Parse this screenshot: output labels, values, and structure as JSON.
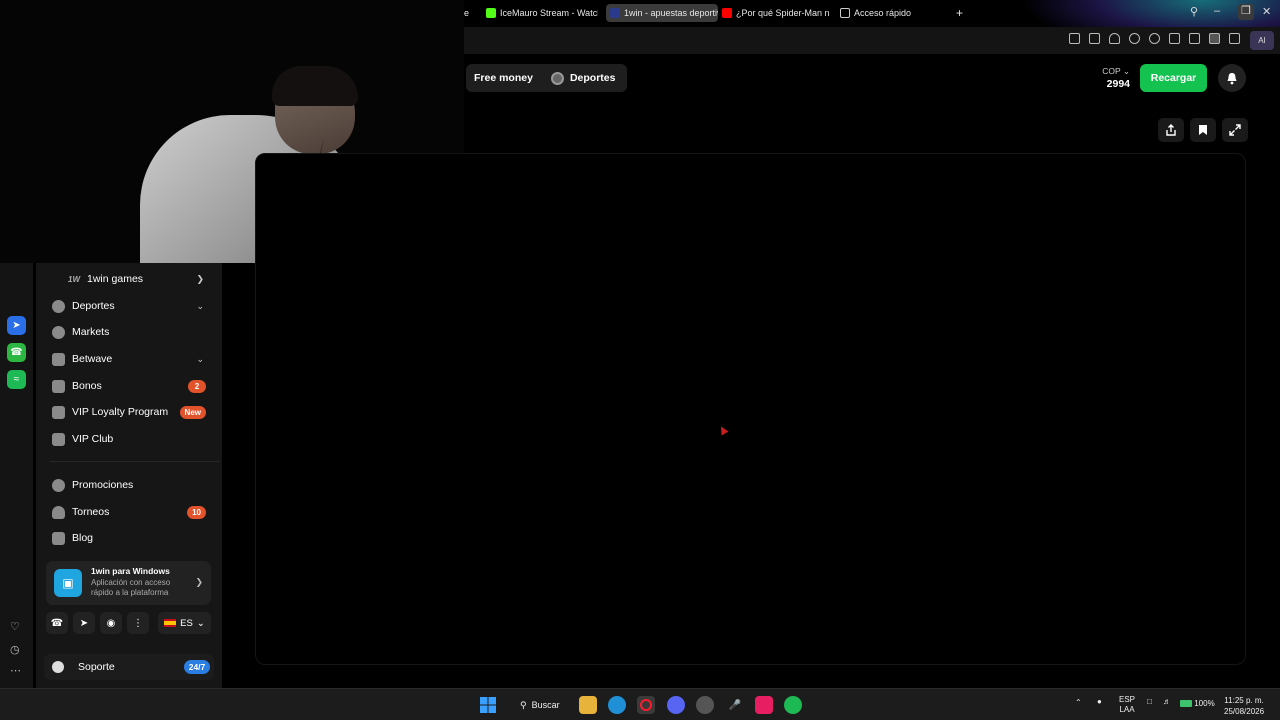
{
  "browser": {
    "tabs": [
      {
        "label": "e",
        "fav_color": "#000000"
      },
      {
        "label": "IceMauro Stream - Watch",
        "fav_color": "#53fc18"
      },
      {
        "label": "1win - apuestas deportiva",
        "fav_color": "#2a3a8c",
        "active": true
      },
      {
        "label": "¿Por qué Spider-Man nun",
        "fav_color": "#ff0000"
      },
      {
        "label": "Acceso rápido",
        "fav_color": "#cccccc"
      }
    ],
    "new_tab_glyph": "+",
    "ai_label": "AI"
  },
  "header": {
    "nav": [
      {
        "label": "Free money"
      },
      {
        "label": "Deportes"
      }
    ],
    "currency": "COP",
    "balance": "2994",
    "recharge_label": "Recargar"
  },
  "sidebar": {
    "items": [
      {
        "label": "1win games",
        "icon": "1w"
      },
      {
        "label": "Deportes",
        "icon": "soccer-ball-icon"
      },
      {
        "label": "Markets",
        "icon": "markets-icon"
      },
      {
        "label": "Betwave",
        "icon": "betwave-icon"
      },
      {
        "label": "Bonos",
        "icon": "gift-icon",
        "badge": "2"
      },
      {
        "label": "VIP Loyalty Program",
        "icon": "trophy-icon",
        "badge": "New"
      },
      {
        "label": "VIP Club",
        "icon": "crown-icon"
      },
      {
        "label": "Promociones",
        "icon": "percent-icon"
      },
      {
        "label": "Torneos",
        "icon": "shield-icon",
        "badge": "10"
      },
      {
        "label": "Blog",
        "icon": "blog-icon"
      }
    ],
    "promo": {
      "title": "1win para Windows",
      "subtitle": "Aplicación con acceso rápido a la plataforma"
    },
    "language": "ES",
    "support_label": "Soporte",
    "support_badge": "24/7"
  },
  "taskbar": {
    "search_label": "Buscar",
    "lang_top": "ESP",
    "lang_bottom": "LAA",
    "battery": "100%",
    "time": "11:25 p. m.",
    "date": "25/08/2026"
  }
}
